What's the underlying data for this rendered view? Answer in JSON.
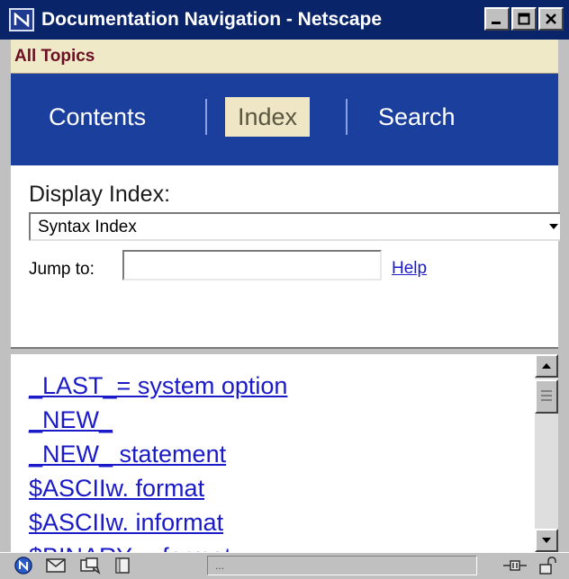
{
  "window": {
    "title": "Documentation Navigation - Netscape",
    "minimize_label": "_",
    "maximize_label": "□",
    "close_label": "✕"
  },
  "topics": {
    "label": "All Topics"
  },
  "tabs": [
    {
      "label": "Contents",
      "active": false
    },
    {
      "label": "Index",
      "active": true
    },
    {
      "label": "Search",
      "active": false
    }
  ],
  "index": {
    "display_label": "Display Index:",
    "selected_index": "Syntax Index",
    "jump_label": "Jump to:",
    "jump_value": "",
    "help_link": "Help"
  },
  "list": {
    "items": [
      "_LAST_= system option",
      "_NEW_",
      "_NEW_ statement",
      "$ASCIIw. format",
      "$ASCIIw. informat",
      "$BINARYw. format"
    ]
  },
  "statusbar": {
    "status_text": "...",
    "icons": [
      "netscape-n-icon",
      "mail-icon",
      "discussion-icon",
      "composer-icon",
      "connection-icon",
      "security-lock-icon"
    ]
  },
  "colors": {
    "titlebar": "#0a246a",
    "tabs_bar": "#1b3f9c",
    "active_tab": "#efe6c6",
    "link": "#1a1ac8",
    "topics_text": "#6b0f24"
  }
}
